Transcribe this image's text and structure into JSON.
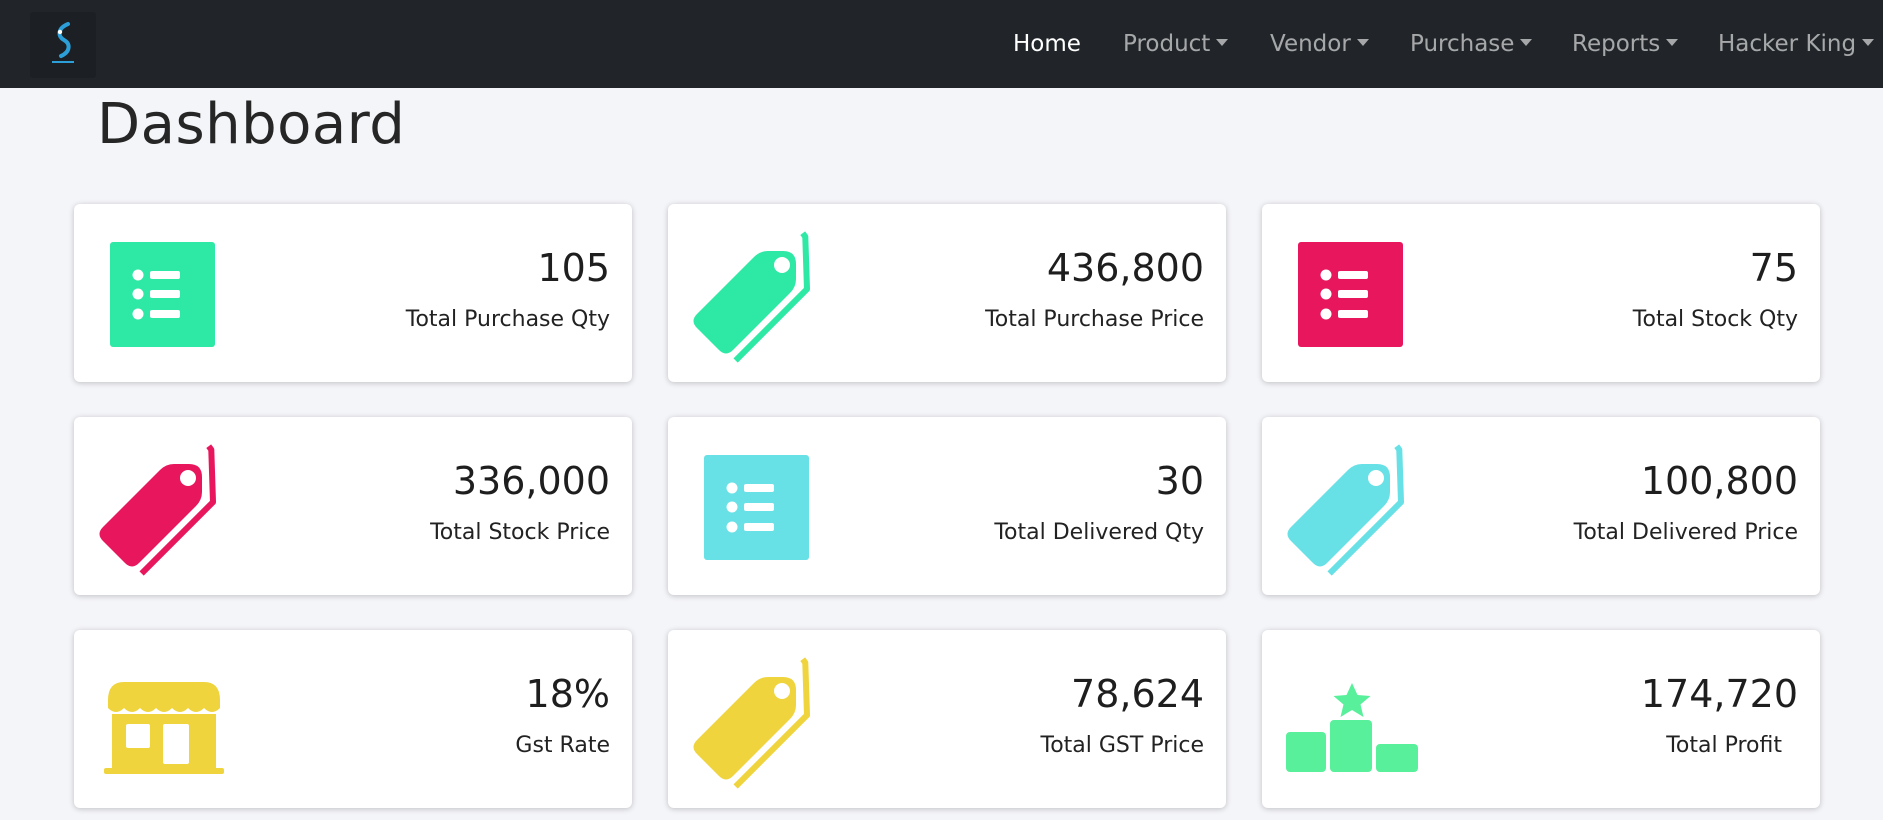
{
  "navbar": {
    "logo_icon": "brand-logo",
    "items": [
      {
        "label": "Home",
        "active": true,
        "dropdown": false
      },
      {
        "label": "Product",
        "active": false,
        "dropdown": true
      },
      {
        "label": "Vendor",
        "active": false,
        "dropdown": true
      },
      {
        "label": "Purchase",
        "active": false,
        "dropdown": true
      },
      {
        "label": "Reports",
        "active": false,
        "dropdown": true
      },
      {
        "label": "Hacker King",
        "active": false,
        "dropdown": true
      }
    ]
  },
  "page": {
    "title": "Dashboard"
  },
  "cards": [
    {
      "value": "105",
      "label": "Total Purchase Qty",
      "icon": "list-icon",
      "color": "#2ee8a5"
    },
    {
      "value": "436,800",
      "label": "Total Purchase Price",
      "icon": "tag-icon",
      "color": "#2ee8a5"
    },
    {
      "value": "75",
      "label": "Total Stock Qty",
      "icon": "list-icon",
      "color": "#e8175d"
    },
    {
      "value": "336,000",
      "label": "Total Stock Price",
      "icon": "tag-icon",
      "color": "#e8175d"
    },
    {
      "value": "30",
      "label": "Total Delivered Qty",
      "icon": "list-icon",
      "color": "#67e0e6"
    },
    {
      "value": "100,800",
      "label": "Total Delivered Price",
      "icon": "tag-icon",
      "color": "#67e0e6"
    },
    {
      "value": "18%",
      "label": "Gst Rate",
      "icon": "store-icon",
      "color": "#efd43d"
    },
    {
      "value": "78,624",
      "label": "Total GST Price",
      "icon": "tag-icon",
      "color": "#efd43d"
    },
    {
      "value": "174,720",
      "label": "Total Profit",
      "icon": "podium-star-icon",
      "color": "#58f09a"
    }
  ]
}
